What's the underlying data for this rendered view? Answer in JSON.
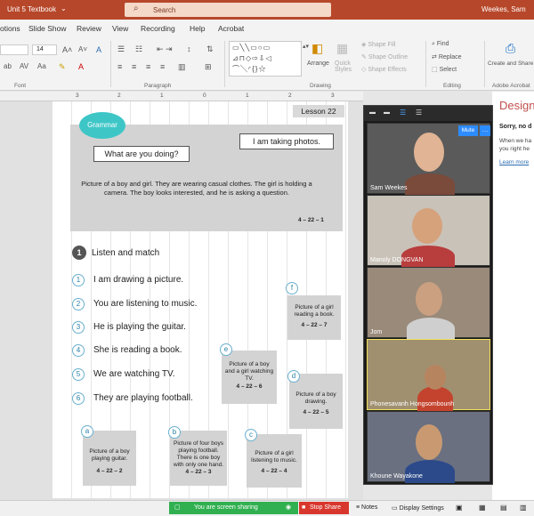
{
  "window": {
    "doc_title": "Unit 5 Textbook",
    "search_placeholder": "Search",
    "user": "Weekes, Sam"
  },
  "menu": [
    "otions",
    "Slide Show",
    "Review",
    "View",
    "Recording",
    "Help",
    "Acrobat"
  ],
  "ribbon": {
    "font_size": "14",
    "groups": {
      "font": "Font",
      "paragraph": "Paragraph",
      "drawing": "Drawing",
      "editing": "Editing",
      "adobe": "Adobe Acrobat"
    },
    "arrange": "Arrange",
    "quick_styles": "Quick Styles",
    "shape_fill": "Shape Fill",
    "shape_outline": "Shape Outline",
    "shape_effects": "Shape Effects",
    "find": "Find",
    "replace": "Replace",
    "select": "Select",
    "create_share": "Create and Share Adobe PDF"
  },
  "ruler": [
    "3",
    "2",
    "1",
    "0",
    "1",
    "2",
    "3"
  ],
  "slide": {
    "lesson": "Lesson 22",
    "grammar": "Grammar",
    "bubble_left": "What are you doing?",
    "bubble_right": "I am taking photos.",
    "scene_desc": "Picture of a boy and girl. They are wearing casual clothes. The girl is holding a camera. The boy looks interested, and he is asking a question.",
    "scene_code": "4 – 22 – 1",
    "section_num": "1",
    "section_title": "Listen and match",
    "sentences": [
      {
        "n": "1",
        "text": "I am drawing a picture."
      },
      {
        "n": "2",
        "text": "You are listening to music."
      },
      {
        "n": "3",
        "text": "He is playing the guitar."
      },
      {
        "n": "4",
        "text": "She is reading a book."
      },
      {
        "n": "5",
        "text": "We are watching TV."
      },
      {
        "n": "6",
        "text": "They are playing football."
      }
    ],
    "cards": {
      "f": {
        "letter": "f",
        "text": "Picture of a girl reading a book.",
        "code": "4 – 22 – 7"
      },
      "e": {
        "letter": "e",
        "text": "Picture of a boy and a girl watching TV.",
        "code": "4 – 22 – 6"
      },
      "d": {
        "letter": "d",
        "text": "Picture of a boy drawing.",
        "code": "4 – 22 – 5"
      },
      "a": {
        "letter": "a",
        "text": "Picture of a boy playing guitar.",
        "code": "4 – 22 – 2"
      },
      "b": {
        "letter": "b",
        "text": "Picture of four boys playing football. There is one boy with only one hand.",
        "code": "4 – 22 – 3"
      },
      "c": {
        "letter": "c",
        "text": "Picture of a girl listening to music.",
        "code": "4 – 22 – 4"
      }
    }
  },
  "design_pane": {
    "title": "Design",
    "sorry": "Sorry, no d",
    "line1": "When we ha",
    "line2": "you right he",
    "link": "Learn more"
  },
  "video": {
    "mute_label": "Mute",
    "participants": [
      "Sam Weekes",
      "Manoly DONGVAN",
      "Jom",
      "Phonesavanh Hongsombounh",
      "Khoune Wayakone"
    ]
  },
  "status": {
    "sharing": "You are screen sharing",
    "stop": "Stop Share",
    "notes": "Notes",
    "display": "Display Settings"
  }
}
